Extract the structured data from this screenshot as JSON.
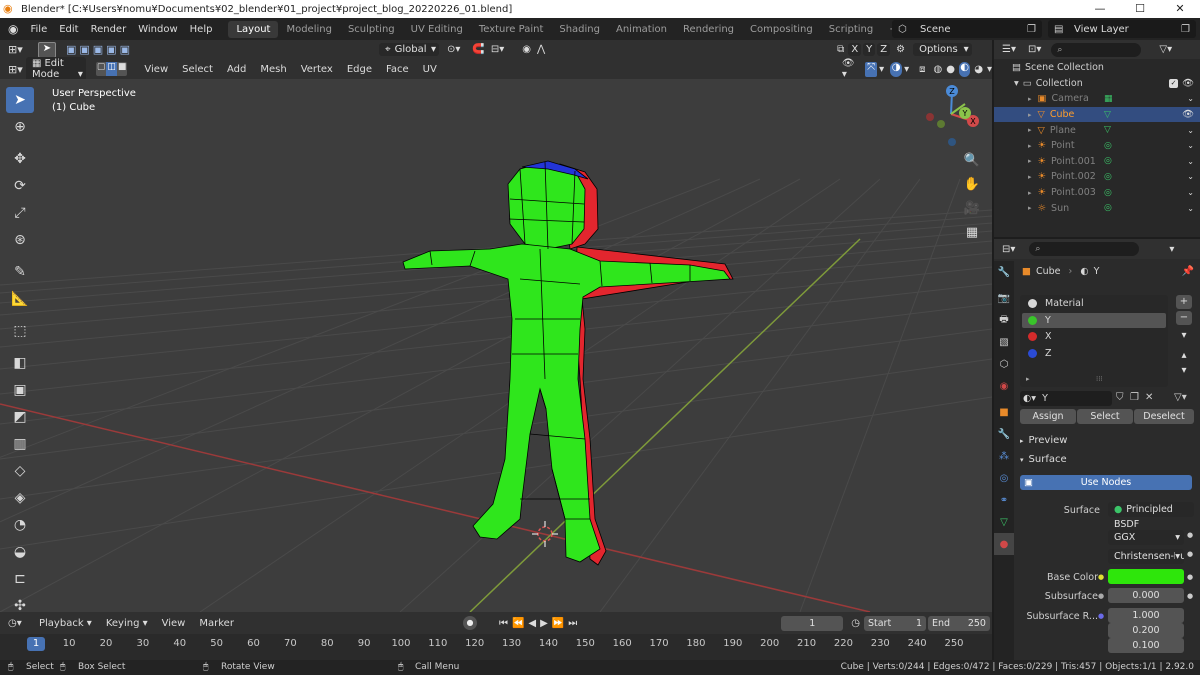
{
  "window": {
    "title": "Blender* [C:¥Users¥nomu¥Documents¥02_blender¥01_project¥project_blog_20220226_01.blend]",
    "controls": {
      "minimize": "—",
      "maximize": "☐",
      "close": "✕"
    }
  },
  "topbar": {
    "menus": [
      "File",
      "Edit",
      "Render",
      "Window",
      "Help"
    ],
    "workspaces": [
      "Layout",
      "Modeling",
      "Sculpting",
      "UV Editing",
      "Texture Paint",
      "Shading",
      "Animation",
      "Rendering",
      "Compositing",
      "Scripting"
    ],
    "active_workspace": "Layout",
    "add_workspace": "+",
    "scene": "Scene",
    "view_layer": "View Layer"
  },
  "tool_header": {
    "orientation": "Global",
    "options": "Options",
    "axes": [
      "X",
      "Y",
      "Z"
    ]
  },
  "viewport_header": {
    "mode": "Edit Mode",
    "menus": [
      "View",
      "Select",
      "Add",
      "Mesh",
      "Vertex",
      "Edge",
      "Face",
      "UV"
    ]
  },
  "viewport": {
    "perspective": "User Perspective",
    "object": "(1) Cube",
    "gizmo": {
      "x": "X",
      "y": "Y",
      "z": "Z"
    }
  },
  "timeline": {
    "menus": [
      "Playback",
      "Keying",
      "View",
      "Marker"
    ],
    "current_frame": "1",
    "start_label": "Start",
    "start": "1",
    "end_label": "End",
    "end": "250",
    "ticks": [
      "1",
      "10",
      "20",
      "30",
      "40",
      "50",
      "60",
      "70",
      "80",
      "90",
      "100",
      "110",
      "120",
      "130",
      "140",
      "150",
      "160",
      "170",
      "180",
      "190",
      "200",
      "210",
      "220",
      "230",
      "240",
      "250"
    ]
  },
  "statusbar": {
    "select": "Select",
    "box_select": "Box Select",
    "rotate": "Rotate View",
    "menu": "Call Menu",
    "stats": "Cube | Verts:0/244 | Edges:0/472 | Faces:0/229 | Tris:457 | Objects:1/1 | 2.92.0"
  },
  "outliner": {
    "scene_collection": "Scene Collection",
    "collection": "Collection",
    "items": [
      {
        "name": "Camera",
        "icon": "camera-icon",
        "selected": false
      },
      {
        "name": "Cube",
        "icon": "mesh-icon",
        "selected": true
      },
      {
        "name": "Plane",
        "icon": "mesh-icon",
        "selected": false
      },
      {
        "name": "Point",
        "icon": "light-icon",
        "selected": false
      },
      {
        "name": "Point.001",
        "icon": "light-icon",
        "selected": false
      },
      {
        "name": "Point.002",
        "icon": "light-icon",
        "selected": false
      },
      {
        "name": "Point.003",
        "icon": "light-icon",
        "selected": false
      },
      {
        "name": "Sun",
        "icon": "sun-icon",
        "selected": false
      }
    ]
  },
  "properties": {
    "object": "Cube",
    "material": "Y",
    "slots": [
      {
        "name": "Material",
        "color": "#d8d8d8"
      },
      {
        "name": "Y",
        "color": "#39c42a"
      },
      {
        "name": "X",
        "color": "#d42b2b"
      },
      {
        "name": "Z",
        "color": "#2b4bd4"
      }
    ],
    "active_slot": "Y",
    "material_name": "Y",
    "assign": "Assign",
    "select": "Select",
    "deselect": "Deselect",
    "preview": "Preview",
    "surface_panel": "Surface",
    "use_nodes": "Use Nodes",
    "surface_label": "Surface",
    "surface_value": "Principled BSDF",
    "distribution": "GGX",
    "subsurface_method": "Christensen-Burle",
    "base_color_label": "Base Color",
    "base_color": "#2ee60b",
    "subsurface_label": "Subsurface",
    "subsurface": "0.000",
    "subsurface_radius_label": "Subsurface R...",
    "subsurface_radius": [
      "1.000",
      "0.200",
      "0.100"
    ]
  }
}
